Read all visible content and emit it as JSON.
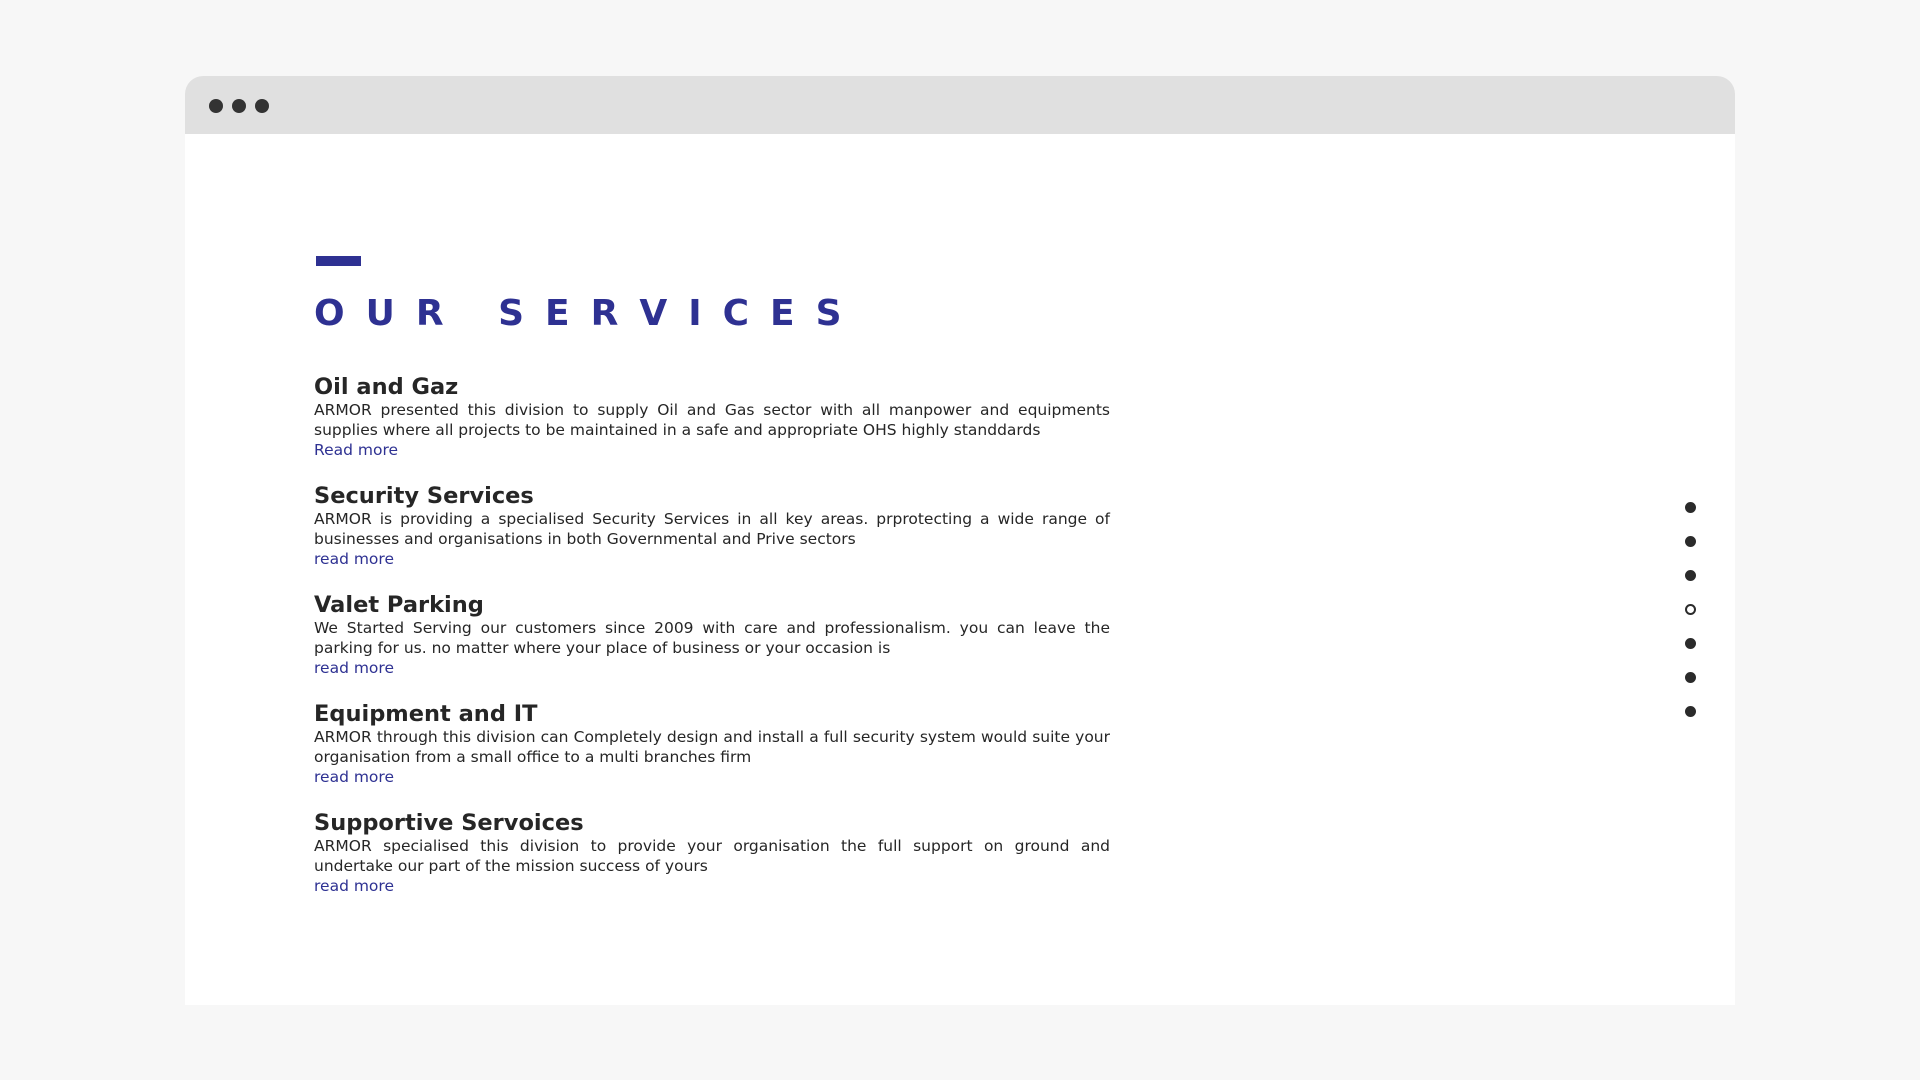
{
  "theme": {
    "accent": "#2e3192",
    "text": "#262626"
  },
  "window": {
    "controls": [
      "dot",
      "dot",
      "dot"
    ]
  },
  "section": {
    "title": "OUR SERVICES",
    "services": [
      {
        "title": "Oil and Gaz",
        "description": "ARMOR presented this division to supply Oil and Gas sector with all manpower and equipments supplies where all projects to be maintained in a safe and appropriate OHS highly standdards",
        "link": "Read more"
      },
      {
        "title": "Security Services",
        "description": "ARMOR is providing a specialised Security Services in all key areas. prprotecting a wide range of businesses and organisations in both Governmental and Prive sectors",
        "link": "read more"
      },
      {
        "title": "Valet Parking",
        "description": "We Started Serving our customers since 2009 with care and professionalism. you can leave the parking for us. no matter where your place of business or your occasion is",
        "link": "read more"
      },
      {
        "title": "Equipment and IT",
        "description": "ARMOR through this division can Completely design and install a full security system would suite your organisation from a small office to a multi branches firm",
        "link": "read more"
      },
      {
        "title": "Supportive Servoices",
        "description": "ARMOR specialised this division to provide your organisation the full support on ground and undertake our part of the mission success of yours",
        "link": "read more"
      }
    ]
  },
  "dot_navigation": {
    "count": 7,
    "active_index": 3
  }
}
